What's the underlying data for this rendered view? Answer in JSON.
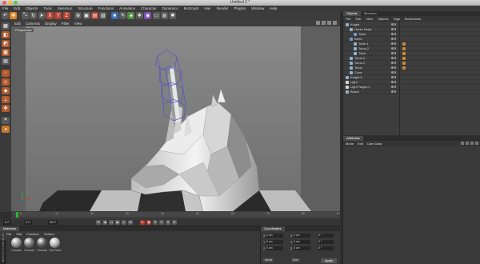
{
  "window": {
    "title": "Untitled 2 *",
    "colors": {
      "close": "#ec5f58",
      "minimize": "#f6bd2f",
      "zoom": "#5fc549"
    }
  },
  "menubar": [
    "File",
    "Edit",
    "Objects",
    "Tools",
    "Selection",
    "Structure",
    "Functions",
    "Animation",
    "Character",
    "Dynamics",
    "MoGraph",
    "Hair",
    "Render",
    "Plugins",
    "Window",
    "Help"
  ],
  "toolbar_icons": [
    {
      "name": "undo-icon",
      "glyph": "↶",
      "color": "#5b5b5b"
    },
    {
      "name": "move-icon",
      "glyph": "✥",
      "color": "#d8872a"
    },
    {
      "name": "scale-icon",
      "glyph": "⤡",
      "color": "#5b5b5b"
    },
    {
      "name": "rotate-icon",
      "glyph": "↻",
      "color": "#5b5b5b"
    },
    {
      "name": "live-select-icon",
      "glyph": "➤",
      "color": "#5b5b5b"
    },
    {
      "name": "x-axis-icon",
      "glyph": "X",
      "color": "#b04636"
    },
    {
      "name": "y-axis-icon",
      "glyph": "Y",
      "color": "#b04636"
    },
    {
      "name": "z-axis-icon",
      "glyph": "Z",
      "color": "#b04636"
    },
    {
      "name": "coordinate-system-icon",
      "glyph": "⊕",
      "color": "#5b5b5b"
    },
    {
      "name": "render-view-icon",
      "glyph": "▣",
      "color": "#5b5b5b"
    },
    {
      "name": "render-picture-viewer-icon",
      "glyph": "▤",
      "color": "#b04636"
    },
    {
      "name": "render-settings-icon",
      "glyph": "▥",
      "color": "#5b5b5b"
    },
    {
      "name": "cube-icon",
      "glyph": "■",
      "color": "#3c6fb0"
    },
    {
      "name": "pen-icon",
      "glyph": "✎",
      "color": "#5b5b5b"
    },
    {
      "name": "subdivision-icon",
      "glyph": "◈",
      "color": "#4e8e3e"
    },
    {
      "name": "array-icon",
      "glyph": "❖",
      "color": "#5b5b5b"
    },
    {
      "name": "deformer-icon",
      "glyph": "◉",
      "color": "#7a4fb0"
    },
    {
      "name": "floor-icon",
      "glyph": "▭",
      "color": "#5b5b5b"
    },
    {
      "name": "camera-icon",
      "glyph": "◍",
      "color": "#5b5b5b"
    },
    {
      "name": "light-icon",
      "glyph": "✺",
      "color": "#5b5b5b"
    }
  ],
  "left_tools": [
    {
      "name": "make-editable-icon",
      "glyph": "▦",
      "color": "#5b5b5b"
    },
    {
      "name": "model-mode-icon",
      "glyph": "◧",
      "color": "#b25a2e"
    },
    {
      "name": "object-mode-icon",
      "glyph": "◩",
      "color": "#b25a2e"
    },
    {
      "name": "texture-mode-icon",
      "glyph": "▩",
      "color": "#b25a2e"
    },
    {
      "name": "workplane-icon",
      "glyph": "▤",
      "color": "#5b5b5b"
    },
    {
      "name": "points-mode-icon",
      "glyph": "⁘",
      "color": "#b25a2e"
    },
    {
      "name": "edges-mode-icon",
      "glyph": "◇",
      "color": "#b25a2e"
    },
    {
      "name": "polygons-mode-icon",
      "glyph": "◆",
      "color": "#b25a2e"
    },
    {
      "name": "axis-mode-icon",
      "glyph": "⊥",
      "color": "#b25a2e"
    },
    {
      "name": "tweak-mode-icon",
      "glyph": "✤",
      "color": "#b25a2e"
    },
    {
      "name": "snap-icon",
      "glyph": "⌖",
      "color": "#5b5b5b"
    },
    {
      "name": "sculpt-icon",
      "glyph": "◕",
      "color": "#c8762b"
    }
  ],
  "viewport": {
    "menu": [
      "Edit",
      "Cameras",
      "Display",
      "Filter",
      "View"
    ],
    "label": "Perspective"
  },
  "object_manager": {
    "tabs": [
      "Objects",
      "Structure"
    ],
    "menu": [
      "File",
      "Edit",
      "View",
      "Objects",
      "Tags",
      "Bookmarks"
    ],
    "items": [
      {
        "name": "Knight",
        "indent": 0,
        "color": "#8fb3d0",
        "tags": []
      },
      {
        "name": "Horse Head",
        "indent": 1,
        "color": "#8fb3d0",
        "tags": []
      },
      {
        "name": "Twist",
        "indent": 2,
        "color": "#6f9ad0",
        "tags": []
      },
      {
        "name": "Bend",
        "indent": 1,
        "color": "#6f9ad0",
        "tags": []
      },
      {
        "name": "Tube.1",
        "indent": 2,
        "color": "#8fb3d0",
        "tags": [
          "#c88a3a"
        ]
      },
      {
        "name": "Torus.2",
        "indent": 2,
        "color": "#8fb3d0",
        "tags": [
          "#c88a3a"
        ]
      },
      {
        "name": "Tube",
        "indent": 2,
        "color": "#8fb3d0",
        "tags": [
          "#c88a3a"
        ]
      },
      {
        "name": "Torus.2",
        "indent": 1,
        "color": "#8fb3d0",
        "tags": [
          "#c88a3a"
        ]
      },
      {
        "name": "Torus.1",
        "indent": 1,
        "color": "#8fb3d0",
        "tags": [
          "#c88a3a"
        ]
      },
      {
        "name": "Torus",
        "indent": 1,
        "color": "#8fb3d0",
        "tags": [
          "#c88a3a"
        ]
      },
      {
        "name": "Cone",
        "indent": 1,
        "color": "#8fb3d0",
        "tags": []
      },
      {
        "name": "Knight.2",
        "indent": 0,
        "color": "#8fb3d0",
        "tags": []
      },
      {
        "name": "Light",
        "indent": 0,
        "color": "#d8d8d8",
        "tags": []
      },
      {
        "name": "Light Target.1",
        "indent": 0,
        "color": "#d8d8d8",
        "tags": []
      },
      {
        "name": "Board",
        "indent": 0,
        "color": "#8fb3d0",
        "tags": []
      }
    ]
  },
  "attribute_manager": {
    "tab": "Attributes",
    "menu": [
      "Mode",
      "Edit",
      "User Data"
    ]
  },
  "timeline": {
    "ticks": [
      "0",
      "10",
      "20",
      "30",
      "40",
      "50",
      "60",
      "70",
      "80",
      "90"
    ],
    "current_frame": "0 F",
    "start_frame": "0 F",
    "end_frame": "90 F"
  },
  "material_manager": {
    "tab": "Materials",
    "menu": [
      "File",
      "Edit",
      "Function",
      "Texture"
    ],
    "materials": [
      {
        "label": "Chrome",
        "color": "#9a9a9a"
      },
      {
        "label": "Chrome",
        "color": "#7a7a7a"
      },
      {
        "label": "Chrome",
        "color": "#5f5f5f"
      },
      {
        "label": "Car Paint",
        "color": "#b7b7b7"
      }
    ]
  },
  "coordinates": {
    "tab": "Coordinates",
    "rows": [
      {
        "axis": "X",
        "pos": "0 cm",
        "size": "0 cm",
        "rot": "0 °"
      },
      {
        "axis": "Y",
        "pos": "0 cm",
        "size": "0 cm",
        "rot": "0 °"
      },
      {
        "axis": "Z",
        "pos": "0 cm",
        "size": "0 cm",
        "rot": "0 °"
      }
    ],
    "mode": "World",
    "size_mode": "Size",
    "apply": "Apply"
  },
  "vertical_logo": "MAXON CINEMA 4D"
}
